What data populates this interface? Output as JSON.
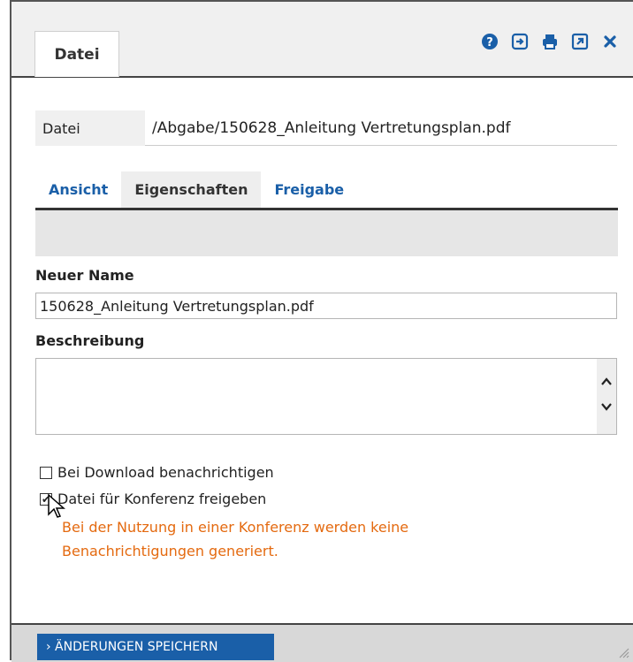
{
  "window": {
    "tab_label": "Datei",
    "icons": [
      "help-icon",
      "exit-icon",
      "print-icon",
      "external-link-icon",
      "close-icon"
    ]
  },
  "file_info": {
    "label": "Datei",
    "path": "/Abgabe/150628_Anleitung Vertretungsplan.pdf"
  },
  "tabs": [
    {
      "label": "Ansicht",
      "active": false
    },
    {
      "label": "Eigenschaften",
      "active": true
    },
    {
      "label": "Freigabe",
      "active": false
    }
  ],
  "form": {
    "new_name_label": "Neuer Name",
    "new_name_value": "150628_Anleitung Vertretungsplan.pdf",
    "description_label": "Beschreibung",
    "description_value": "",
    "notify_label": "Bei Download benachrichtigen",
    "notify_checked": false,
    "conference_label": "Datei für Konferenz freigeben",
    "conference_checked": true,
    "warning_line1": "Bei der Nutzung in einer Konferenz werden keine",
    "warning_line2": "Benachrichtigungen generiert."
  },
  "footer": {
    "save_label": "› ÄNDERUNGEN SPEICHERN"
  },
  "colors": {
    "accent": "#1a5fa8",
    "warning": "#e46a10"
  }
}
